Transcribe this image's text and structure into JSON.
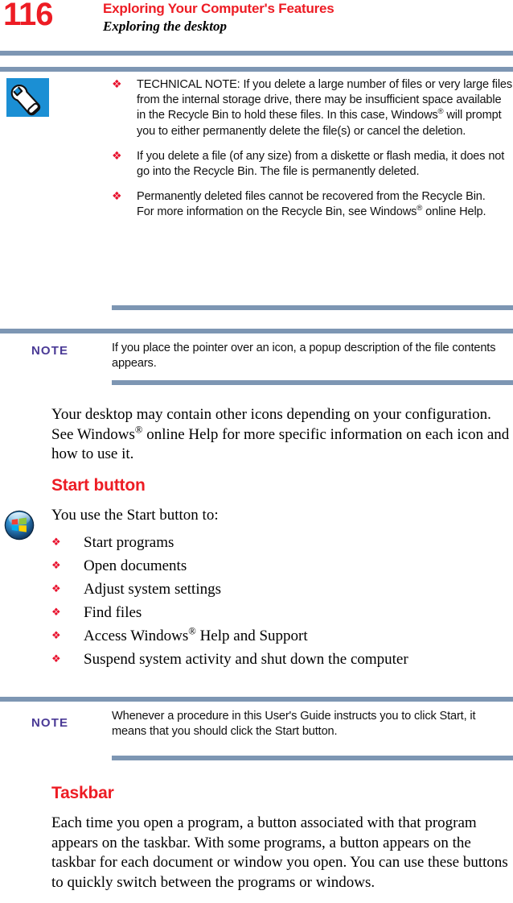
{
  "header": {
    "page_number": "116",
    "chapter_title": "Exploring Your Computer's Features",
    "section_title": "Exploring the desktop",
    "rule_color": "#7d96b3",
    "accent_red": "#ed1c24"
  },
  "technical_note": {
    "icon": "wrench-icon",
    "icon_background": "#1b8fd4",
    "bullet_glyph": "❖",
    "bullet_color": "#e8112d",
    "items": [
      {
        "id": "technical-note-bullet-1",
        "parts": [
          {
            "text": "TECHNICAL NOTE: If you delete a large number of files or very large files from the internal storage drive, there may be insufficient space available in the Recycle Bin to hold these files. In this case, Windows"
          },
          {
            "text": "®",
            "style": "sup"
          },
          {
            "text": " will prompt you to either permanently delete the file(s) or cancel the deletion."
          }
        ]
      },
      {
        "id": "technical-note-bullet-2",
        "parts": [
          {
            "text": "If you delete a file (of any size) from a diskette or flash media, it does not go into the Recycle Bin. The file is permanently deleted."
          }
        ]
      },
      {
        "id": "technical-note-bullet-3",
        "parts": [
          {
            "text": "Permanently deleted files cannot be recovered from the Recycle Bin."
          },
          {
            "text": "",
            "style": "break"
          },
          {
            "text": "For more information on the Recycle Bin, see Windows"
          },
          {
            "text": "®",
            "style": "sup"
          },
          {
            "text": " online Help."
          }
        ]
      }
    ]
  },
  "note_one": {
    "label": "NOTE",
    "label_color": "#4a3a96",
    "text": "If you place the pointer over an icon, a popup description of the file contents appears."
  },
  "desktop_paragraph": {
    "parts": [
      {
        "text": "Your desktop may contain other icons depending on your configuration. See Windows"
      },
      {
        "text": "®",
        "style": "sup"
      },
      {
        "text": " online Help for more specific information on each icon and how to use it."
      }
    ]
  },
  "start_button_section": {
    "heading": "Start button",
    "icon": "windows-start-orb-icon",
    "intro": "You use the Start button to:",
    "bullet_glyph": "❖",
    "items": [
      {
        "id": "start-bullet-1",
        "parts": [
          {
            "text": "Start programs"
          }
        ]
      },
      {
        "id": "start-bullet-2",
        "parts": [
          {
            "text": "Open documents"
          }
        ]
      },
      {
        "id": "start-bullet-3",
        "parts": [
          {
            "text": "Adjust system settings"
          }
        ]
      },
      {
        "id": "start-bullet-4",
        "parts": [
          {
            "text": "Find files"
          }
        ]
      },
      {
        "id": "start-bullet-5",
        "parts": [
          {
            "text": "Access Windows"
          },
          {
            "text": "®",
            "style": "sup"
          },
          {
            "text": " Help and Support"
          }
        ]
      },
      {
        "id": "start-bullet-6",
        "parts": [
          {
            "text": "Suspend system activity and shut down the computer"
          }
        ]
      }
    ]
  },
  "note_two": {
    "label": "NOTE",
    "label_color": "#4a3a96",
    "text": "Whenever a procedure in this User's Guide instructs you to click Start, it means that you should click the Start button."
  },
  "taskbar_section": {
    "heading": "Taskbar",
    "paragraph": "Each time you open a program, a button associated with that program appears on the taskbar. With some programs, a button appears on the taskbar for each document or window you open. You can use these buttons to quickly switch between the programs or windows."
  }
}
